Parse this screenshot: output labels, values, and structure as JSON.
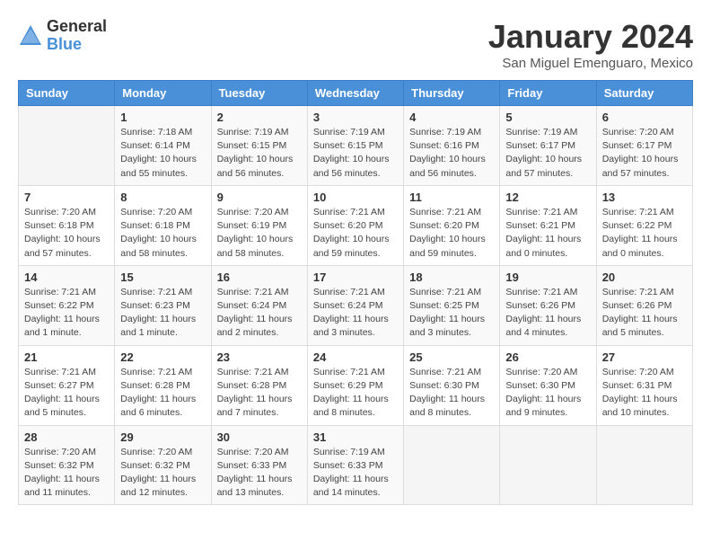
{
  "header": {
    "logo_general": "General",
    "logo_blue": "Blue",
    "month_title": "January 2024",
    "location": "San Miguel Emenguaro, Mexico"
  },
  "weekdays": [
    "Sunday",
    "Monday",
    "Tuesday",
    "Wednesday",
    "Thursday",
    "Friday",
    "Saturday"
  ],
  "weeks": [
    [
      {
        "day": "",
        "detail": ""
      },
      {
        "day": "1",
        "detail": "Sunrise: 7:18 AM\nSunset: 6:14 PM\nDaylight: 10 hours\nand 55 minutes."
      },
      {
        "day": "2",
        "detail": "Sunrise: 7:19 AM\nSunset: 6:15 PM\nDaylight: 10 hours\nand 56 minutes."
      },
      {
        "day": "3",
        "detail": "Sunrise: 7:19 AM\nSunset: 6:15 PM\nDaylight: 10 hours\nand 56 minutes."
      },
      {
        "day": "4",
        "detail": "Sunrise: 7:19 AM\nSunset: 6:16 PM\nDaylight: 10 hours\nand 56 minutes."
      },
      {
        "day": "5",
        "detail": "Sunrise: 7:19 AM\nSunset: 6:17 PM\nDaylight: 10 hours\nand 57 minutes."
      },
      {
        "day": "6",
        "detail": "Sunrise: 7:20 AM\nSunset: 6:17 PM\nDaylight: 10 hours\nand 57 minutes."
      }
    ],
    [
      {
        "day": "7",
        "detail": "Sunrise: 7:20 AM\nSunset: 6:18 PM\nDaylight: 10 hours\nand 57 minutes."
      },
      {
        "day": "8",
        "detail": "Sunrise: 7:20 AM\nSunset: 6:18 PM\nDaylight: 10 hours\nand 58 minutes."
      },
      {
        "day": "9",
        "detail": "Sunrise: 7:20 AM\nSunset: 6:19 PM\nDaylight: 10 hours\nand 58 minutes."
      },
      {
        "day": "10",
        "detail": "Sunrise: 7:21 AM\nSunset: 6:20 PM\nDaylight: 10 hours\nand 59 minutes."
      },
      {
        "day": "11",
        "detail": "Sunrise: 7:21 AM\nSunset: 6:20 PM\nDaylight: 10 hours\nand 59 minutes."
      },
      {
        "day": "12",
        "detail": "Sunrise: 7:21 AM\nSunset: 6:21 PM\nDaylight: 11 hours\nand 0 minutes."
      },
      {
        "day": "13",
        "detail": "Sunrise: 7:21 AM\nSunset: 6:22 PM\nDaylight: 11 hours\nand 0 minutes."
      }
    ],
    [
      {
        "day": "14",
        "detail": "Sunrise: 7:21 AM\nSunset: 6:22 PM\nDaylight: 11 hours\nand 1 minute."
      },
      {
        "day": "15",
        "detail": "Sunrise: 7:21 AM\nSunset: 6:23 PM\nDaylight: 11 hours\nand 1 minute."
      },
      {
        "day": "16",
        "detail": "Sunrise: 7:21 AM\nSunset: 6:24 PM\nDaylight: 11 hours\nand 2 minutes."
      },
      {
        "day": "17",
        "detail": "Sunrise: 7:21 AM\nSunset: 6:24 PM\nDaylight: 11 hours\nand 3 minutes."
      },
      {
        "day": "18",
        "detail": "Sunrise: 7:21 AM\nSunset: 6:25 PM\nDaylight: 11 hours\nand 3 minutes."
      },
      {
        "day": "19",
        "detail": "Sunrise: 7:21 AM\nSunset: 6:26 PM\nDaylight: 11 hours\nand 4 minutes."
      },
      {
        "day": "20",
        "detail": "Sunrise: 7:21 AM\nSunset: 6:26 PM\nDaylight: 11 hours\nand 5 minutes."
      }
    ],
    [
      {
        "day": "21",
        "detail": "Sunrise: 7:21 AM\nSunset: 6:27 PM\nDaylight: 11 hours\nand 5 minutes."
      },
      {
        "day": "22",
        "detail": "Sunrise: 7:21 AM\nSunset: 6:28 PM\nDaylight: 11 hours\nand 6 minutes."
      },
      {
        "day": "23",
        "detail": "Sunrise: 7:21 AM\nSunset: 6:28 PM\nDaylight: 11 hours\nand 7 minutes."
      },
      {
        "day": "24",
        "detail": "Sunrise: 7:21 AM\nSunset: 6:29 PM\nDaylight: 11 hours\nand 8 minutes."
      },
      {
        "day": "25",
        "detail": "Sunrise: 7:21 AM\nSunset: 6:30 PM\nDaylight: 11 hours\nand 8 minutes."
      },
      {
        "day": "26",
        "detail": "Sunrise: 7:20 AM\nSunset: 6:30 PM\nDaylight: 11 hours\nand 9 minutes."
      },
      {
        "day": "27",
        "detail": "Sunrise: 7:20 AM\nSunset: 6:31 PM\nDaylight: 11 hours\nand 10 minutes."
      }
    ],
    [
      {
        "day": "28",
        "detail": "Sunrise: 7:20 AM\nSunset: 6:32 PM\nDaylight: 11 hours\nand 11 minutes."
      },
      {
        "day": "29",
        "detail": "Sunrise: 7:20 AM\nSunset: 6:32 PM\nDaylight: 11 hours\nand 12 minutes."
      },
      {
        "day": "30",
        "detail": "Sunrise: 7:20 AM\nSunset: 6:33 PM\nDaylight: 11 hours\nand 13 minutes."
      },
      {
        "day": "31",
        "detail": "Sunrise: 7:19 AM\nSunset: 6:33 PM\nDaylight: 11 hours\nand 14 minutes."
      },
      {
        "day": "",
        "detail": ""
      },
      {
        "day": "",
        "detail": ""
      },
      {
        "day": "",
        "detail": ""
      }
    ]
  ]
}
